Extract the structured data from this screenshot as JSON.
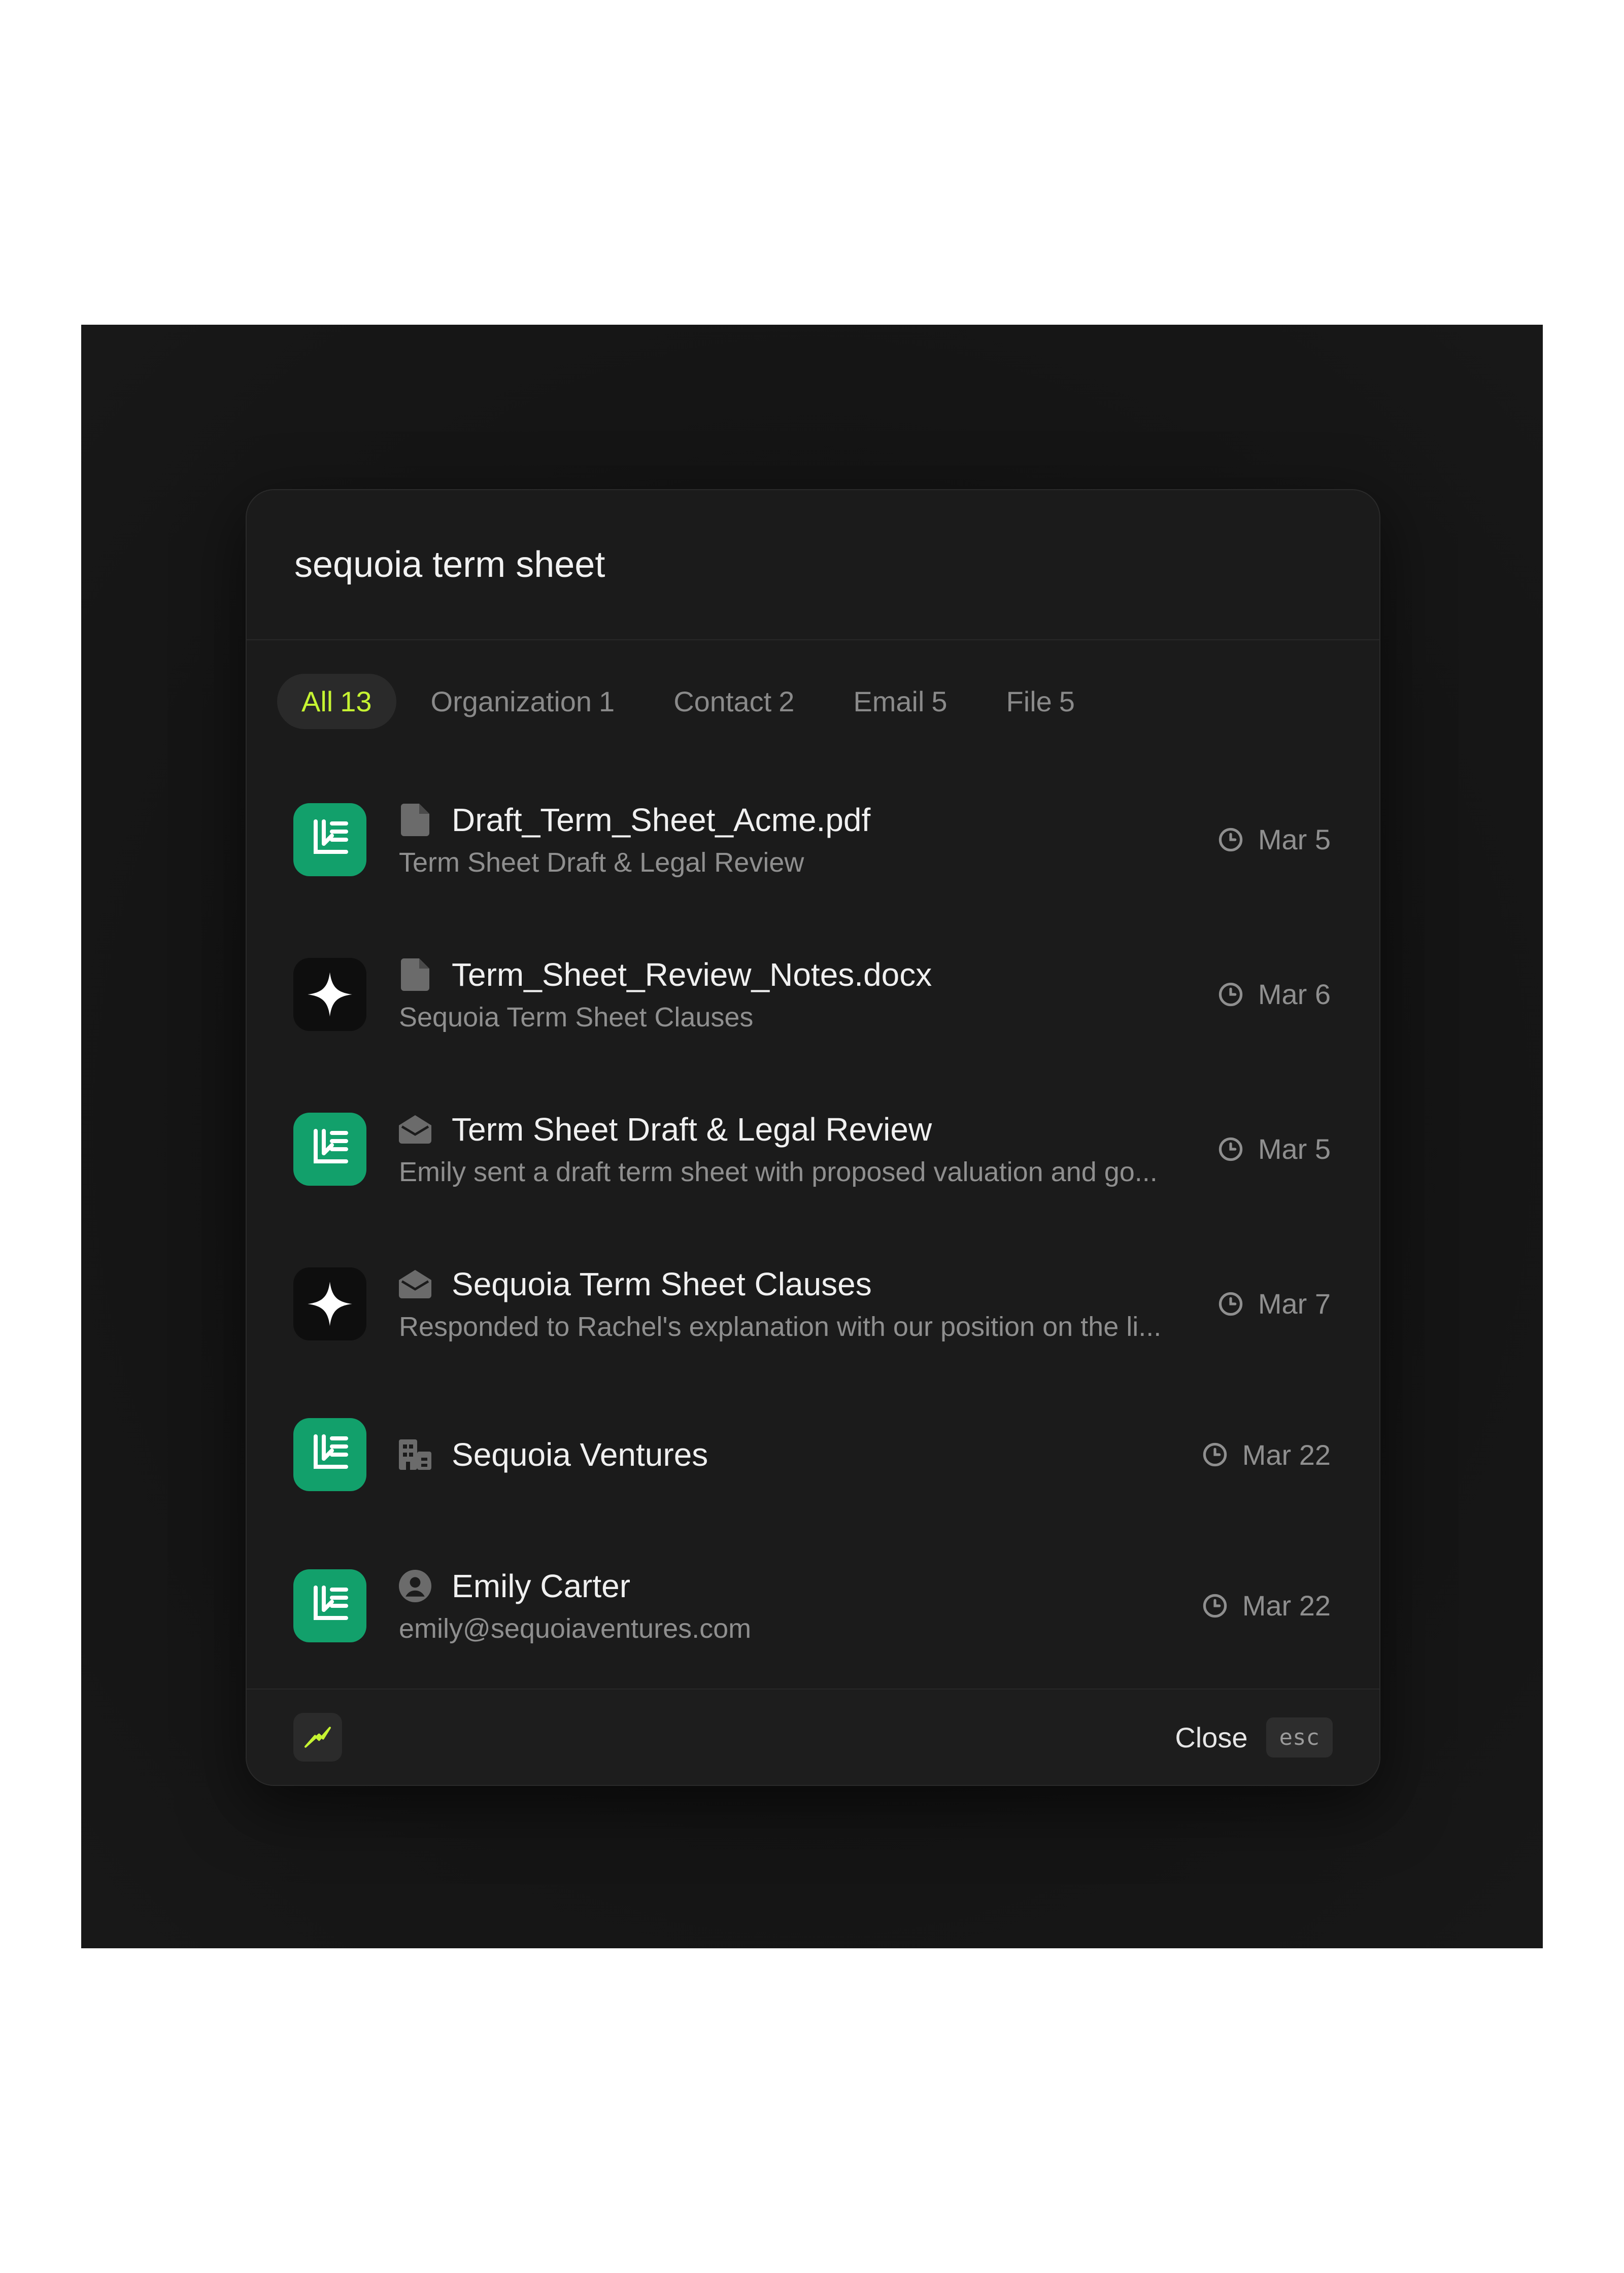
{
  "search": {
    "query": "sequoia term sheet"
  },
  "tabs": [
    {
      "label": "All",
      "count": "13",
      "active": true
    },
    {
      "label": "Organization",
      "count": "1"
    },
    {
      "label": "Contact",
      "count": "2"
    },
    {
      "label": "Email",
      "count": "5"
    },
    {
      "label": "File",
      "count": "5"
    }
  ],
  "results": [
    {
      "app": "green-app",
      "type": "file",
      "title": "Draft_Term_Sheet_Acme.pdf",
      "subtitle": "Term Sheet Draft & Legal Review",
      "date": "Mar 5"
    },
    {
      "app": "sparkle-app",
      "type": "file",
      "title": "Term_Sheet_Review_Notes.docx",
      "subtitle": "Sequoia Term Sheet Clauses",
      "date": "Mar 6"
    },
    {
      "app": "green-app",
      "type": "email",
      "title": "Term Sheet Draft & Legal Review",
      "subtitle": "Emily sent a draft term sheet with proposed valuation and go...",
      "date": "Mar 5"
    },
    {
      "app": "sparkle-app",
      "type": "email",
      "title": "Sequoia Term Sheet Clauses",
      "subtitle": "Responded to Rachel's explanation with our position on the li...",
      "date": "Mar 7"
    },
    {
      "app": "green-app",
      "type": "organization",
      "title": "Sequoia Ventures",
      "subtitle": "",
      "date": "Mar 22"
    },
    {
      "app": "green-app",
      "type": "contact",
      "title": "Emily Carter",
      "subtitle": "emily@sequoiaventures.com",
      "date": "Mar 22"
    }
  ],
  "footer": {
    "close_label": "Close",
    "shortcut": "esc"
  },
  "colors": {
    "accent": "#c6f432",
    "app_green": "#12a06b",
    "panel": "#1b1b1b"
  },
  "icons": {
    "file": "file-icon",
    "email": "envelope-icon",
    "organization": "building-icon",
    "contact": "user-circle-icon",
    "date": "clock-icon",
    "footer": "bolt-icon"
  }
}
